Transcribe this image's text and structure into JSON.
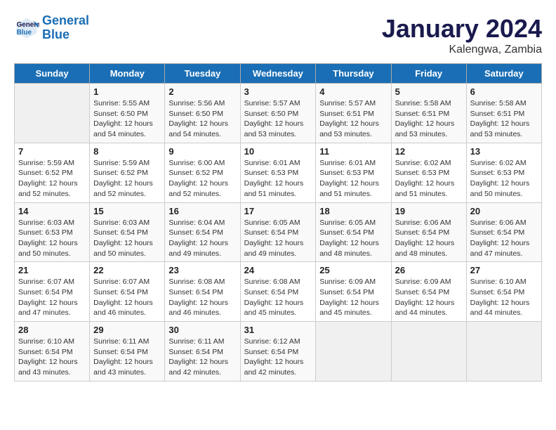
{
  "header": {
    "logo_line1": "General",
    "logo_line2": "Blue",
    "month": "January 2024",
    "location": "Kalengwa, Zambia"
  },
  "weekdays": [
    "Sunday",
    "Monday",
    "Tuesday",
    "Wednesday",
    "Thursday",
    "Friday",
    "Saturday"
  ],
  "weeks": [
    [
      {
        "day": "",
        "info": ""
      },
      {
        "day": "1",
        "info": "Sunrise: 5:55 AM\nSunset: 6:50 PM\nDaylight: 12 hours and 54 minutes."
      },
      {
        "day": "2",
        "info": "Sunrise: 5:56 AM\nSunset: 6:50 PM\nDaylight: 12 hours and 54 minutes."
      },
      {
        "day": "3",
        "info": "Sunrise: 5:57 AM\nSunset: 6:50 PM\nDaylight: 12 hours and 53 minutes."
      },
      {
        "day": "4",
        "info": "Sunrise: 5:57 AM\nSunset: 6:51 PM\nDaylight: 12 hours and 53 minutes."
      },
      {
        "day": "5",
        "info": "Sunrise: 5:58 AM\nSunset: 6:51 PM\nDaylight: 12 hours and 53 minutes."
      },
      {
        "day": "6",
        "info": "Sunrise: 5:58 AM\nSunset: 6:51 PM\nDaylight: 12 hours and 53 minutes."
      }
    ],
    [
      {
        "day": "7",
        "info": "Sunrise: 5:59 AM\nSunset: 6:52 PM\nDaylight: 12 hours and 52 minutes."
      },
      {
        "day": "8",
        "info": "Sunrise: 5:59 AM\nSunset: 6:52 PM\nDaylight: 12 hours and 52 minutes."
      },
      {
        "day": "9",
        "info": "Sunrise: 6:00 AM\nSunset: 6:52 PM\nDaylight: 12 hours and 52 minutes."
      },
      {
        "day": "10",
        "info": "Sunrise: 6:01 AM\nSunset: 6:53 PM\nDaylight: 12 hours and 51 minutes."
      },
      {
        "day": "11",
        "info": "Sunrise: 6:01 AM\nSunset: 6:53 PM\nDaylight: 12 hours and 51 minutes."
      },
      {
        "day": "12",
        "info": "Sunrise: 6:02 AM\nSunset: 6:53 PM\nDaylight: 12 hours and 51 minutes."
      },
      {
        "day": "13",
        "info": "Sunrise: 6:02 AM\nSunset: 6:53 PM\nDaylight: 12 hours and 50 minutes."
      }
    ],
    [
      {
        "day": "14",
        "info": "Sunrise: 6:03 AM\nSunset: 6:53 PM\nDaylight: 12 hours and 50 minutes."
      },
      {
        "day": "15",
        "info": "Sunrise: 6:03 AM\nSunset: 6:54 PM\nDaylight: 12 hours and 50 minutes."
      },
      {
        "day": "16",
        "info": "Sunrise: 6:04 AM\nSunset: 6:54 PM\nDaylight: 12 hours and 49 minutes."
      },
      {
        "day": "17",
        "info": "Sunrise: 6:05 AM\nSunset: 6:54 PM\nDaylight: 12 hours and 49 minutes."
      },
      {
        "day": "18",
        "info": "Sunrise: 6:05 AM\nSunset: 6:54 PM\nDaylight: 12 hours and 48 minutes."
      },
      {
        "day": "19",
        "info": "Sunrise: 6:06 AM\nSunset: 6:54 PM\nDaylight: 12 hours and 48 minutes."
      },
      {
        "day": "20",
        "info": "Sunrise: 6:06 AM\nSunset: 6:54 PM\nDaylight: 12 hours and 47 minutes."
      }
    ],
    [
      {
        "day": "21",
        "info": "Sunrise: 6:07 AM\nSunset: 6:54 PM\nDaylight: 12 hours and 47 minutes."
      },
      {
        "day": "22",
        "info": "Sunrise: 6:07 AM\nSunset: 6:54 PM\nDaylight: 12 hours and 46 minutes."
      },
      {
        "day": "23",
        "info": "Sunrise: 6:08 AM\nSunset: 6:54 PM\nDaylight: 12 hours and 46 minutes."
      },
      {
        "day": "24",
        "info": "Sunrise: 6:08 AM\nSunset: 6:54 PM\nDaylight: 12 hours and 45 minutes."
      },
      {
        "day": "25",
        "info": "Sunrise: 6:09 AM\nSunset: 6:54 PM\nDaylight: 12 hours and 45 minutes."
      },
      {
        "day": "26",
        "info": "Sunrise: 6:09 AM\nSunset: 6:54 PM\nDaylight: 12 hours and 44 minutes."
      },
      {
        "day": "27",
        "info": "Sunrise: 6:10 AM\nSunset: 6:54 PM\nDaylight: 12 hours and 44 minutes."
      }
    ],
    [
      {
        "day": "28",
        "info": "Sunrise: 6:10 AM\nSunset: 6:54 PM\nDaylight: 12 hours and 43 minutes."
      },
      {
        "day": "29",
        "info": "Sunrise: 6:11 AM\nSunset: 6:54 PM\nDaylight: 12 hours and 43 minutes."
      },
      {
        "day": "30",
        "info": "Sunrise: 6:11 AM\nSunset: 6:54 PM\nDaylight: 12 hours and 42 minutes."
      },
      {
        "day": "31",
        "info": "Sunrise: 6:12 AM\nSunset: 6:54 PM\nDaylight: 12 hours and 42 minutes."
      },
      {
        "day": "",
        "info": ""
      },
      {
        "day": "",
        "info": ""
      },
      {
        "day": "",
        "info": ""
      }
    ]
  ]
}
